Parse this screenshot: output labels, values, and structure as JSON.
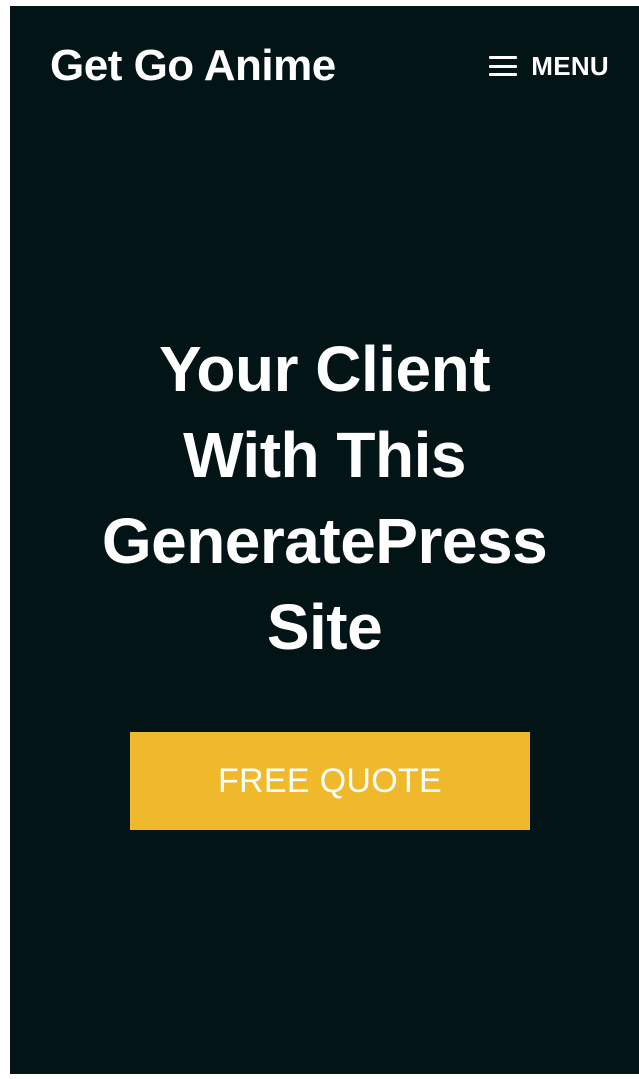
{
  "header": {
    "site_title": "Get Go Anime",
    "menu_label": "MENU",
    "menu_icon": "hamburger-icon"
  },
  "hero": {
    "title_lines": [
      "Your Client",
      "With This",
      "GeneratePress",
      "Site"
    ],
    "cta_label": "FREE QUOTE"
  },
  "colors": {
    "page_background": "#ffffff",
    "hero_background": "#021416",
    "text": "#ffffff",
    "cta_background": "#f0b82b"
  }
}
